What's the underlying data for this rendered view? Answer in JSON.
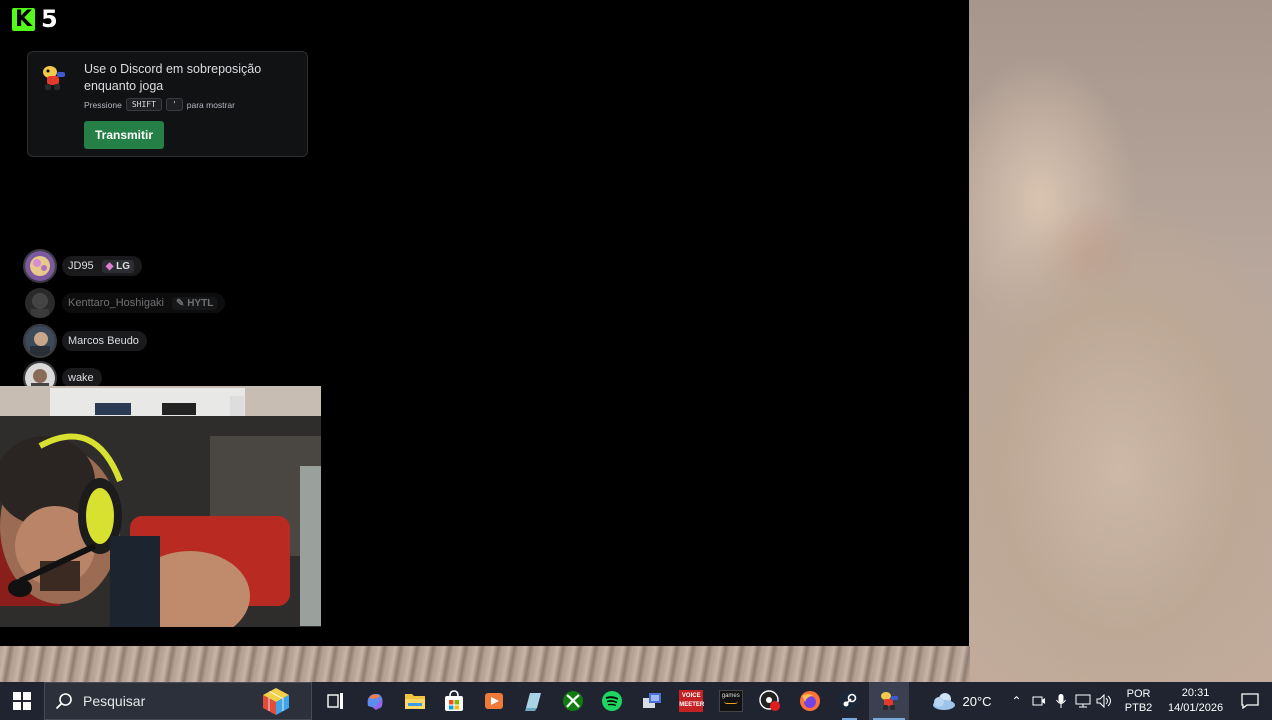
{
  "game_overlay": {
    "logo_letter": "K",
    "logo_number": "5"
  },
  "discord_overlay": {
    "title": "Use o Discord em sobreposição enquanto joga",
    "hint_prefix": "Pressione",
    "hint_key1": "SHIFT",
    "hint_key2": "'",
    "hint_suffix": "para mostrar",
    "button_label": "Transmitir",
    "button_color": "#248046"
  },
  "voice_users": [
    {
      "name": "JD95",
      "tag": "LG",
      "tag_icon": "gem-icon",
      "muted": false
    },
    {
      "name": "Kenttaro_Hoshigaki",
      "tag": "HYTL",
      "tag_icon": "pencil-icon",
      "muted": true
    },
    {
      "name": "Marcos Beudo",
      "muted": false
    },
    {
      "name": "wake",
      "muted": false
    }
  ],
  "taskbar": {
    "search_placeholder": "Pesquisar",
    "apps": [
      "task-view-icon",
      "copilot-icon",
      "file-explorer-icon",
      "store-icon",
      "media-player-icon",
      "notepad-icon",
      "xbox-icon",
      "spotify-icon",
      "network-app-icon",
      "voicemeeter-icon",
      "amazon-games-icon",
      "obs-icon",
      "firefox-icon",
      "steam-icon",
      "discord-icon"
    ],
    "weather_temp": "20°C",
    "language_line1": "POR",
    "language_line2": "PTB2",
    "time": "20:31",
    "date": "14/01/2026",
    "voicemeeter_label_top": "VOICE",
    "voicemeeter_label_bottom": "MEETER",
    "amazon_label": "games"
  }
}
